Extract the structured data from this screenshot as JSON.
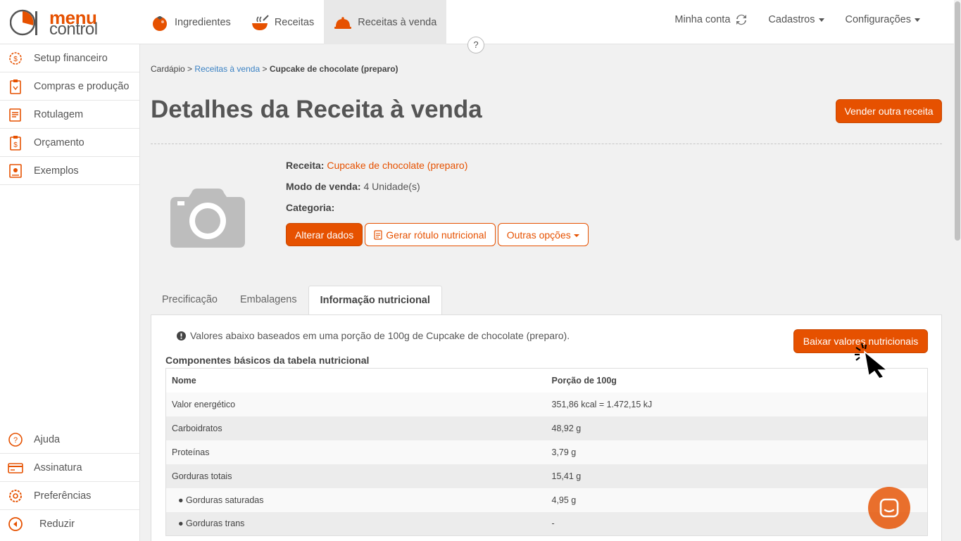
{
  "app": {
    "logo_word1": "menu",
    "logo_word2": "control",
    "accent": "#e65100",
    "link_color": "#3b82c4"
  },
  "topnav": {
    "items": [
      {
        "label": "Ingredientes",
        "icon": "tomato-icon"
      },
      {
        "label": "Receitas",
        "icon": "pot-icon"
      },
      {
        "label": "Receitas à venda",
        "icon": "cloche-icon",
        "active": true
      }
    ],
    "account_label": "Minha conta",
    "cadastros_label": "Cadastros",
    "config_label": "Configurações",
    "help_label": "?"
  },
  "sidebar": {
    "items": [
      {
        "label": "Setup financeiro",
        "icon": "gear-dollar-icon"
      },
      {
        "label": "Compras e produção",
        "icon": "clipboard-icon"
      },
      {
        "label": "Rotulagem",
        "icon": "label-icon"
      },
      {
        "label": "Orçamento",
        "icon": "budget-icon"
      },
      {
        "label": "Exemplos",
        "icon": "book-icon"
      }
    ],
    "bottom_items": [
      {
        "label": "Ajuda",
        "icon": "help-icon"
      },
      {
        "label": "Assinatura",
        "icon": "card-icon"
      },
      {
        "label": "Preferências",
        "icon": "gear-icon"
      },
      {
        "label": "Reduzir",
        "icon": "collapse-icon"
      }
    ]
  },
  "breadcrumb": {
    "root": "Cardápio",
    "sep1": ">",
    "middle": "Receitas à venda",
    "sep2": ">",
    "current": "Cupcake de chocolate (preparo)"
  },
  "page": {
    "title": "Detalhes da Receita à venda",
    "sell_other_label": "Vender outra receita"
  },
  "recipe": {
    "recipe_label": "Receita:",
    "recipe_value": "Cupcake de chocolate (preparo)",
    "mode_label": "Modo de venda:",
    "mode_value": "4 Unidade(s)",
    "category_label": "Categoria:",
    "btn_edit": "Alterar dados",
    "btn_label": "Gerar rótulo nutricional",
    "btn_more": "Outras opções"
  },
  "tabs": [
    {
      "label": "Precificação"
    },
    {
      "label": "Embalagens"
    },
    {
      "label": "Informação nutricional",
      "active": true
    }
  ],
  "nutrition": {
    "note": "Valores abaixo baseados em uma porção de 100g de Cupcake de chocolate (preparo).",
    "download_label": "Baixar valores nutricionais",
    "section_title": "Componentes básicos da tabela nutricional",
    "headers": [
      "Nome",
      "Porção de 100g"
    ],
    "rows": [
      {
        "name": "Valor energético",
        "value": "351,86 kcal = 1.472,15 kJ"
      },
      {
        "name": "Carboidratos",
        "value": "48,92 g"
      },
      {
        "name": "Proteínas",
        "value": "3,79 g"
      },
      {
        "name": "Gorduras totais",
        "value": "15,41 g"
      },
      {
        "name": "● Gorduras saturadas",
        "value": "4,95 g"
      },
      {
        "name": "● Gorduras trans",
        "value": "-"
      }
    ]
  }
}
